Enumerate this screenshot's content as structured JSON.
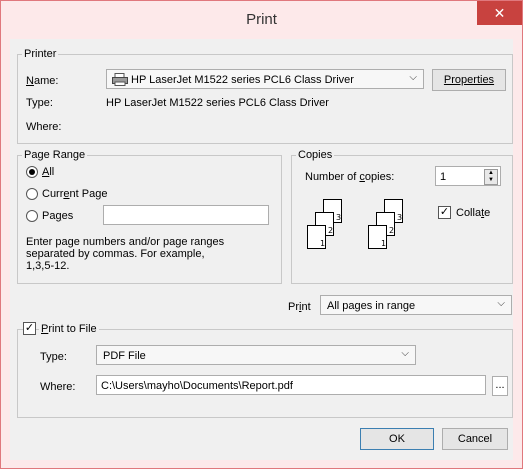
{
  "window": {
    "title": "Print",
    "close_glyph": "✕"
  },
  "printer": {
    "group_label": "Printer",
    "name_label": "Name:",
    "name_value": "HP LaserJet M1522 series PCL6 Class Driver",
    "properties_label": "Properties",
    "type_label": "Type:",
    "type_value": "HP LaserJet M1522 series PCL6 Class Driver",
    "where_label": "Where:"
  },
  "page_range": {
    "group_label": "Page Range",
    "all_label": "All",
    "current_label": "Current Page",
    "pages_label": "Pages",
    "pages_value": "",
    "help_text_1": "Enter page numbers and/or page ranges",
    "help_text_2": "separated by commas.  For example,",
    "help_text_3": "1,3,5-12.",
    "selected": "all"
  },
  "copies": {
    "group_label": "Copies",
    "number_label": "Number of copies:",
    "number_value": "1",
    "collate_label": "Collate",
    "collate_checked": true,
    "collate_icon_pages": [
      "1",
      "2",
      "3",
      "1",
      "2",
      "3"
    ]
  },
  "print_what": {
    "label": "Print",
    "value": "All pages in range"
  },
  "print_to_file": {
    "label": "Print to File",
    "checked": true,
    "type_label": "Type:",
    "type_value": "PDF File",
    "where_label": "Where:",
    "where_value": "C:\\Users\\mayho\\Documents\\Report.pdf",
    "browse_label": "..."
  },
  "buttons": {
    "ok": "OK",
    "cancel": "Cancel"
  },
  "colors": {
    "close_button": "#c8423f",
    "title_bar": "#fde9ea",
    "client": "#f0f0f0"
  }
}
